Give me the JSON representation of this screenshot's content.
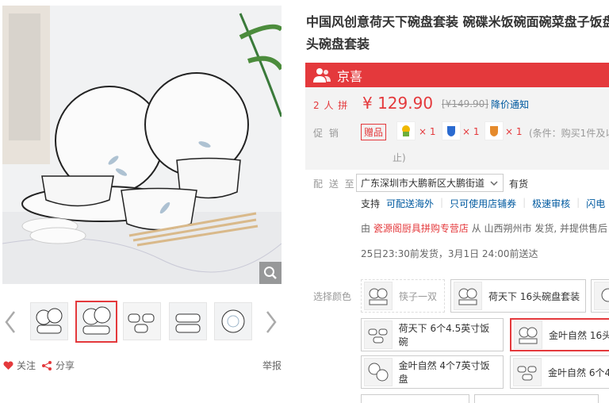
{
  "product": {
    "title": "中国风创意荷天下碗盘套装 碗碟米饭碗面碗菜盘子饭盘 头碗盘套装"
  },
  "brand_bar": {
    "icon": "users-icon",
    "name": "京喜"
  },
  "price": {
    "group_label": "2 人 拼",
    "currency_price": "¥ 129.90",
    "original_price": "[¥149.90]",
    "notify_label": "降价通知"
  },
  "promo": {
    "label": "促  销",
    "gift_tag": "赠品",
    "gifts": [
      {
        "icon": "gift-item-icon",
        "qty": "× 1"
      },
      {
        "icon": "gift-item-icon",
        "qty": "× 1"
      },
      {
        "icon": "gift-item-icon",
        "qty": "× 1"
      }
    ],
    "condition": "(条件：购买1件及以",
    "condition_end": "止)"
  },
  "delivery": {
    "label": "配 送 至",
    "address": "广东深圳市大鹏新区大鹏街道",
    "stock": "有货",
    "services": [
      "支持",
      "可配送海外",
      "只可使用店铺券",
      "极速审核",
      "闪电"
    ],
    "seller_prefix": "由",
    "seller": "瓷源阁厨具拼购专营店",
    "seller_suffix": "从 山西朔州市 发货, 并提供售后",
    "eta": "25日23:30前发货，3月1日 24:00前送达"
  },
  "color_select": {
    "label": "选择颜色",
    "options": [
      {
        "label": "筷子一双",
        "state": "disabled"
      },
      {
        "label": "荷天下 16头碗盘套装",
        "state": "normal"
      },
      {
        "label": "",
        "state": "normal"
      },
      {
        "label": "荷天下 6个4.5英寸饭碗",
        "state": "normal"
      },
      {
        "label": "金叶自然 16头",
        "state": "selected"
      },
      {
        "label": "金叶自然 4个7英寸饭盘",
        "state": "normal"
      },
      {
        "label": "金叶自然 6个4",
        "state": "normal"
      }
    ]
  },
  "gallery": {
    "thumb_count": 5,
    "selected_index": 1
  },
  "actions": {
    "follow": "关注",
    "share": "分享",
    "report": "举报"
  },
  "colors": {
    "accent": "#e4393c",
    "link": "#005aa0",
    "price_bg": "#f3f3f3"
  }
}
